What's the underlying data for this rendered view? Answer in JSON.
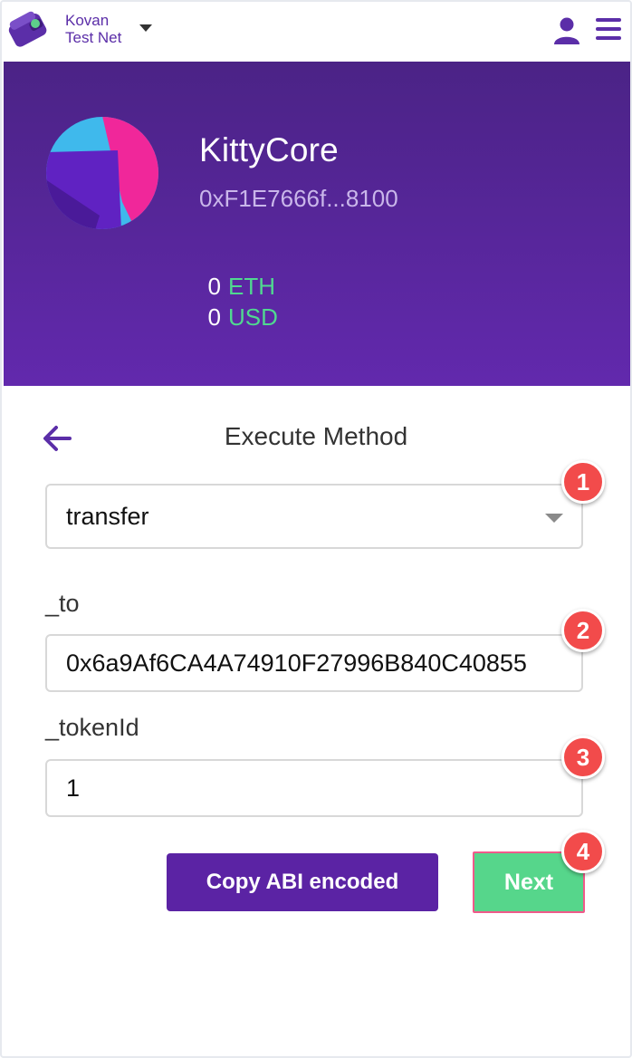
{
  "topbar": {
    "network_line1": "Kovan",
    "network_line2": "Test Net",
    "icons": {
      "logo": "wallet-logo",
      "user": "user-icon",
      "menu": "hamburger-menu-icon",
      "network_dropdown": "caret-down-icon"
    }
  },
  "contract": {
    "name": "KittyCore",
    "address": "0xF1E7666f...8100",
    "balances": [
      {
        "amount": "0",
        "currency": "ETH"
      },
      {
        "amount": "0",
        "currency": "USD"
      }
    ]
  },
  "form": {
    "title": "Execute Method",
    "method": "transfer",
    "params": [
      {
        "label": "_to",
        "value": "0x6a9Af6CA4A74910F27996B840C40855"
      },
      {
        "label": "_tokenId",
        "value": "1"
      }
    ],
    "copy_button": "Copy ABI encoded",
    "next_button": "Next"
  },
  "step_badges": [
    "1",
    "2",
    "3",
    "4"
  ],
  "colors": {
    "header_top": "#4b2386",
    "header_bottom": "#6229ad",
    "accent_purple": "#5b23a4",
    "currency_green": "#50d890",
    "next_green": "#56d68b",
    "badge_red": "#f24b4b"
  }
}
